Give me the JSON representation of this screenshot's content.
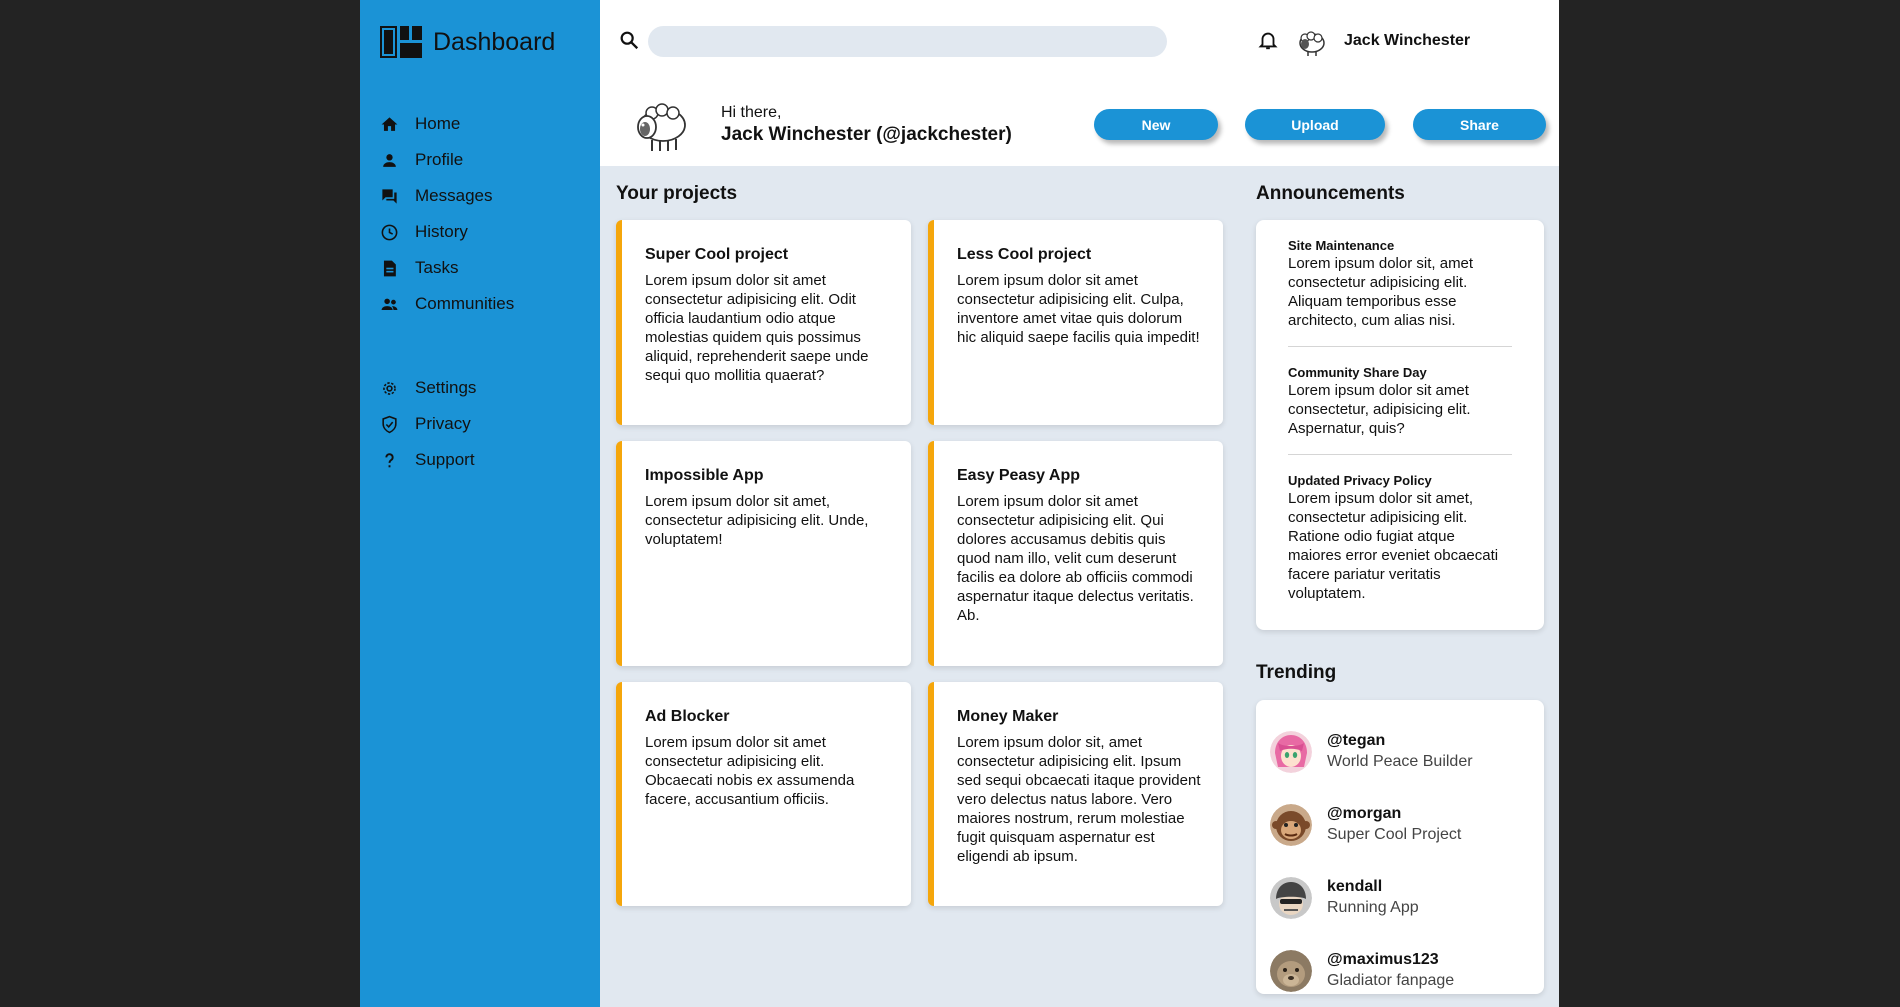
{
  "brand": {
    "title": "Dashboard"
  },
  "sidebar": {
    "items": [
      {
        "label": "Home",
        "icon": "home-icon"
      },
      {
        "label": "Profile",
        "icon": "person-icon"
      },
      {
        "label": "Messages",
        "icon": "chat-icon"
      },
      {
        "label": "History",
        "icon": "clock-icon"
      },
      {
        "label": "Tasks",
        "icon": "document-icon"
      },
      {
        "label": "Communities",
        "icon": "group-icon"
      }
    ],
    "secondary": [
      {
        "label": "Settings",
        "icon": "gear-icon"
      },
      {
        "label": "Privacy",
        "icon": "shield-icon"
      },
      {
        "label": "Support",
        "icon": "question-icon"
      }
    ]
  },
  "header": {
    "search_placeholder": "",
    "username": "Jack Winchester"
  },
  "greeting": {
    "hi": "Hi there,",
    "name": "Jack Winchester (@jackchester)",
    "buttons": {
      "new": "New",
      "upload": "Upload",
      "share": "Share"
    }
  },
  "projects": {
    "title": "Your projects",
    "items": [
      {
        "title": "Super Cool project",
        "body": "Lorem ipsum dolor sit amet consectetur adipisicing elit. Odit officia laudantium odio atque molestias quidem quis possimus aliquid, reprehenderit saepe unde sequi quo mollitia quaerat?"
      },
      {
        "title": "Less Cool project",
        "body": "Lorem ipsum dolor sit amet consectetur adipisicing elit. Culpa, inventore amet vitae quis dolorum hic aliquid saepe facilis quia impedit!"
      },
      {
        "title": "Impossible App",
        "body": "Lorem ipsum dolor sit amet, consectetur adipisicing elit. Unde, voluptatem!"
      },
      {
        "title": "Easy Peasy App",
        "body": "Lorem ipsum dolor sit amet consectetur adipisicing elit. Qui dolores accusamus debitis quis quod nam illo, velit cum deserunt facilis ea dolore ab officiis commodi aspernatur itaque delectus veritatis. Ab."
      },
      {
        "title": "Ad Blocker",
        "body": "Lorem ipsum dolor sit amet consectetur adipisicing elit. Obcaecati nobis ex assumenda facere, accusantium officiis."
      },
      {
        "title": "Money Maker",
        "body": "Lorem ipsum dolor sit, amet consectetur adipisicing elit. Ipsum sed sequi obcaecati itaque provident vero delectus natus labore. Vero maiores nostrum, rerum molestiae fugit quisquam aspernatur est eligendi ab ipsum."
      }
    ]
  },
  "announcements": {
    "title": "Announcements",
    "items": [
      {
        "title": "Site Maintenance",
        "body": "Lorem ipsum dolor sit, amet consectetur adipisicing elit. Aliquam temporibus esse architecto, cum alias nisi."
      },
      {
        "title": "Community Share Day",
        "body": "Lorem ipsum dolor sit amet consectetur, adipisicing elit. Aspernatur, quis?"
      },
      {
        "title": "Updated Privacy Policy",
        "body": "Lorem ipsum dolor sit amet, consectetur adipisicing elit. Ratione odio fugiat atque maiores error eveniet obcaecati facere pariatur veritatis voluptatem."
      }
    ]
  },
  "trending": {
    "title": "Trending",
    "items": [
      {
        "handle": "@tegan",
        "subtitle": "World Peace Builder"
      },
      {
        "handle": "@morgan",
        "subtitle": "Super Cool Project"
      },
      {
        "handle": "kendall",
        "subtitle": "Running App"
      },
      {
        "handle": "@maximus123",
        "subtitle": "Gladiator fanpage"
      }
    ]
  },
  "colors": {
    "sidebar": "#1b93d6",
    "accent": "#f5a60b",
    "background": "#e1e8f0"
  }
}
